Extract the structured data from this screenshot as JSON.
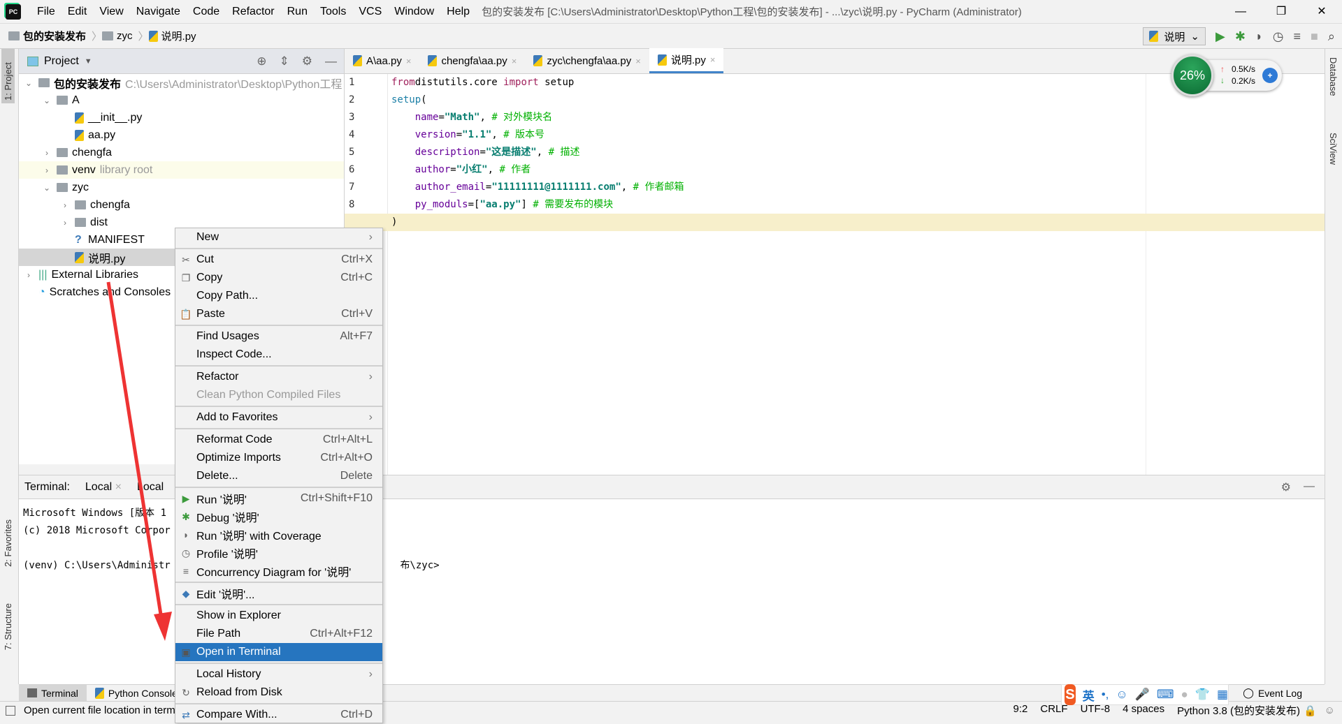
{
  "window": {
    "title": "包的安装发布 [C:\\Users\\Administrator\\Desktop\\Python工程\\包的安装发布] - ...\\zyc\\说明.py - PyCharm (Administrator)",
    "controls": [
      "—",
      "❐",
      "✕"
    ]
  },
  "menu": [
    "File",
    "Edit",
    "View",
    "Navigate",
    "Code",
    "Refactor",
    "Run",
    "Tools",
    "VCS",
    "Window",
    "Help"
  ],
  "breadcrumb": [
    "包的安装发布",
    "zyc",
    "说明.py"
  ],
  "run_config": "说明",
  "left_strip": {
    "project": "1: Project",
    "favorites": "2: Favorites",
    "structure": "7: Structure"
  },
  "right_strip": {
    "database": "Database",
    "sciview": "SciView"
  },
  "project": {
    "title": "Project",
    "tree": [
      {
        "label": "包的安装发布",
        "hint": "C:\\Users\\Administrator\\Desktop\\Python工程",
        "level": 0,
        "type": "folder",
        "open": true,
        "bold": true
      },
      {
        "label": "A",
        "level": 1,
        "type": "pkg",
        "open": true
      },
      {
        "label": "__init__.py",
        "level": 2,
        "type": "py"
      },
      {
        "label": "aa.py",
        "level": 2,
        "type": "py"
      },
      {
        "label": "chengfa",
        "level": 1,
        "type": "pkg",
        "open": false
      },
      {
        "label": "venv",
        "hint": "library root",
        "level": 1,
        "type": "folder",
        "open": false
      },
      {
        "label": "zyc",
        "level": 1,
        "type": "folder",
        "open": true
      },
      {
        "label": "chengfa",
        "level": 2,
        "type": "folder",
        "open": false
      },
      {
        "label": "dist",
        "level": 2,
        "type": "folder",
        "open": false
      },
      {
        "label": "MANIFEST",
        "level": 2,
        "type": "unknown"
      },
      {
        "label": "说明.py",
        "level": 2,
        "type": "py",
        "selected": true
      },
      {
        "label": "External Libraries",
        "level": 0,
        "type": "lib",
        "open": false
      },
      {
        "label": "Scratches and Consoles",
        "level": 0,
        "type": "scratch"
      }
    ]
  },
  "tabs": [
    {
      "label": "A\\aa.py"
    },
    {
      "label": "chengfa\\aa.py"
    },
    {
      "label": "zyc\\chengfa\\aa.py"
    },
    {
      "label": "说明.py",
      "active": true
    }
  ],
  "code": {
    "lines": [
      [
        [
          "kw",
          "from"
        ],
        [
          "",
          "distutils.core "
        ],
        [
          "kw",
          "import"
        ],
        [
          "",
          " setup"
        ]
      ],
      [
        [
          "fn",
          "setup"
        ],
        [
          "",
          "("
        ]
      ],
      [
        [
          "",
          "    "
        ],
        [
          "pa",
          "name"
        ],
        [
          "",
          "="
        ],
        [
          "st",
          "\"Math\""
        ],
        [
          "",
          ", "
        ],
        [
          "cm",
          "# 对外模块名"
        ]
      ],
      [
        [
          "",
          "    "
        ],
        [
          "pa",
          "version"
        ],
        [
          "",
          "="
        ],
        [
          "st",
          "\"1.1\""
        ],
        [
          "",
          ", "
        ],
        [
          "cm",
          "# 版本号"
        ]
      ],
      [
        [
          "",
          "    "
        ],
        [
          "pa",
          "description"
        ],
        [
          "",
          "="
        ],
        [
          "st",
          "\"这是描述\""
        ],
        [
          "",
          ", "
        ],
        [
          "cm",
          "# 描述"
        ]
      ],
      [
        [
          "",
          "    "
        ],
        [
          "pa",
          "author"
        ],
        [
          "",
          "="
        ],
        [
          "st",
          "\"小红\""
        ],
        [
          "",
          ", "
        ],
        [
          "cm",
          "# 作者"
        ]
      ],
      [
        [
          "",
          "    "
        ],
        [
          "pa",
          "author_email"
        ],
        [
          "",
          "="
        ],
        [
          "st",
          "\"11111111@1111111.com\""
        ],
        [
          "",
          ", "
        ],
        [
          "cm",
          "# 作者邮箱"
        ]
      ],
      [
        [
          "",
          "    "
        ],
        [
          "pa",
          "py_moduls"
        ],
        [
          "",
          "=["
        ],
        [
          "st",
          "\"aa.py\""
        ],
        [
          "",
          "] "
        ],
        [
          "cm",
          "# 需要发布的模块"
        ]
      ],
      [
        [
          "",
          ")"
        ]
      ]
    ],
    "current_line": 9
  },
  "speed_widget": {
    "percent": "26%",
    "up": "0.5K/s",
    "down": "0.2K/s"
  },
  "terminal": {
    "label": "Terminal:",
    "tabs": [
      "Local",
      "Local"
    ],
    "lines": [
      "Microsoft Windows [版本 1",
      "(c) 2018 Microsoft Corpor",
      "",
      "(venv) C:\\Users\\Administr                                       布\\zyc>"
    ]
  },
  "bottom_tabs": [
    "Terminal",
    "Python Console",
    "Event Log"
  ],
  "status": {
    "message": "Open current file location in terminal",
    "position": "9:2",
    "line_sep": "CRLF",
    "encoding": "UTF-8",
    "indent": "4 spaces",
    "interpreter": "Python 3.8 (包的安装发布)"
  },
  "ime": {
    "mode": "英"
  },
  "context_menu": [
    {
      "label": "New",
      "submenu": true
    },
    {
      "sep": true
    },
    {
      "label": "Cut",
      "shortcut": "Ctrl+X",
      "icon": "scissors-icon",
      "glyph": "✂"
    },
    {
      "label": "Copy",
      "shortcut": "Ctrl+C",
      "icon": "copy-icon",
      "glyph": "❐"
    },
    {
      "label": "Copy Path..."
    },
    {
      "label": "Paste",
      "shortcut": "Ctrl+V",
      "icon": "paste-icon",
      "glyph": "📋"
    },
    {
      "sep": true
    },
    {
      "label": "Find Usages",
      "shortcut": "Alt+F7"
    },
    {
      "label": "Inspect Code..."
    },
    {
      "sep": true
    },
    {
      "label": "Refactor",
      "submenu": true
    },
    {
      "label": "Clean Python Compiled Files",
      "disabled": true
    },
    {
      "sep": true
    },
    {
      "label": "Add to Favorites",
      "submenu": true
    },
    {
      "sep": true
    },
    {
      "label": "Reformat Code",
      "shortcut": "Ctrl+Alt+L"
    },
    {
      "label": "Optimize Imports",
      "shortcut": "Ctrl+Alt+O"
    },
    {
      "label": "Delete...",
      "shortcut": "Delete"
    },
    {
      "sep": true
    },
    {
      "label": "Run '说明'",
      "shortcut": "Ctrl+Shift+F10",
      "icon": "run-icon",
      "glyph": "▶",
      "color": "#3c9a3c"
    },
    {
      "label": "Debug '说明'",
      "icon": "debug-icon",
      "glyph": "✱",
      "color": "#3c9a3c"
    },
    {
      "label": "Run '说明' with Coverage",
      "icon": "coverage-icon",
      "glyph": "◗"
    },
    {
      "label": "Profile '说明'",
      "icon": "profile-icon",
      "glyph": "◷"
    },
    {
      "label": "Concurrency Diagram for '说明'",
      "icon": "concurrency-icon",
      "glyph": "≡"
    },
    {
      "sep": true
    },
    {
      "label": "Edit '说明'...",
      "icon": "python-icon",
      "glyph": "◆",
      "color": "#3d7ab8"
    },
    {
      "sep": true
    },
    {
      "label": "Show in Explorer"
    },
    {
      "label": "File Path",
      "shortcut": "Ctrl+Alt+F12"
    },
    {
      "label": "Open in Terminal",
      "highlighted": true,
      "icon": "terminal-icon",
      "glyph": "▣"
    },
    {
      "sep": true
    },
    {
      "label": "Local History",
      "submenu": true
    },
    {
      "label": "Reload from Disk",
      "icon": "reload-icon",
      "glyph": "↻"
    },
    {
      "sep": true
    },
    {
      "label": "Compare With...",
      "shortcut": "Ctrl+D",
      "icon": "compare-icon",
      "glyph": "⇄",
      "color": "#3d7ab8"
    }
  ],
  "colors": {
    "accent": "#2675bf",
    "annotation_arrow": "#ee3333",
    "current_line": "#f7efcb"
  }
}
